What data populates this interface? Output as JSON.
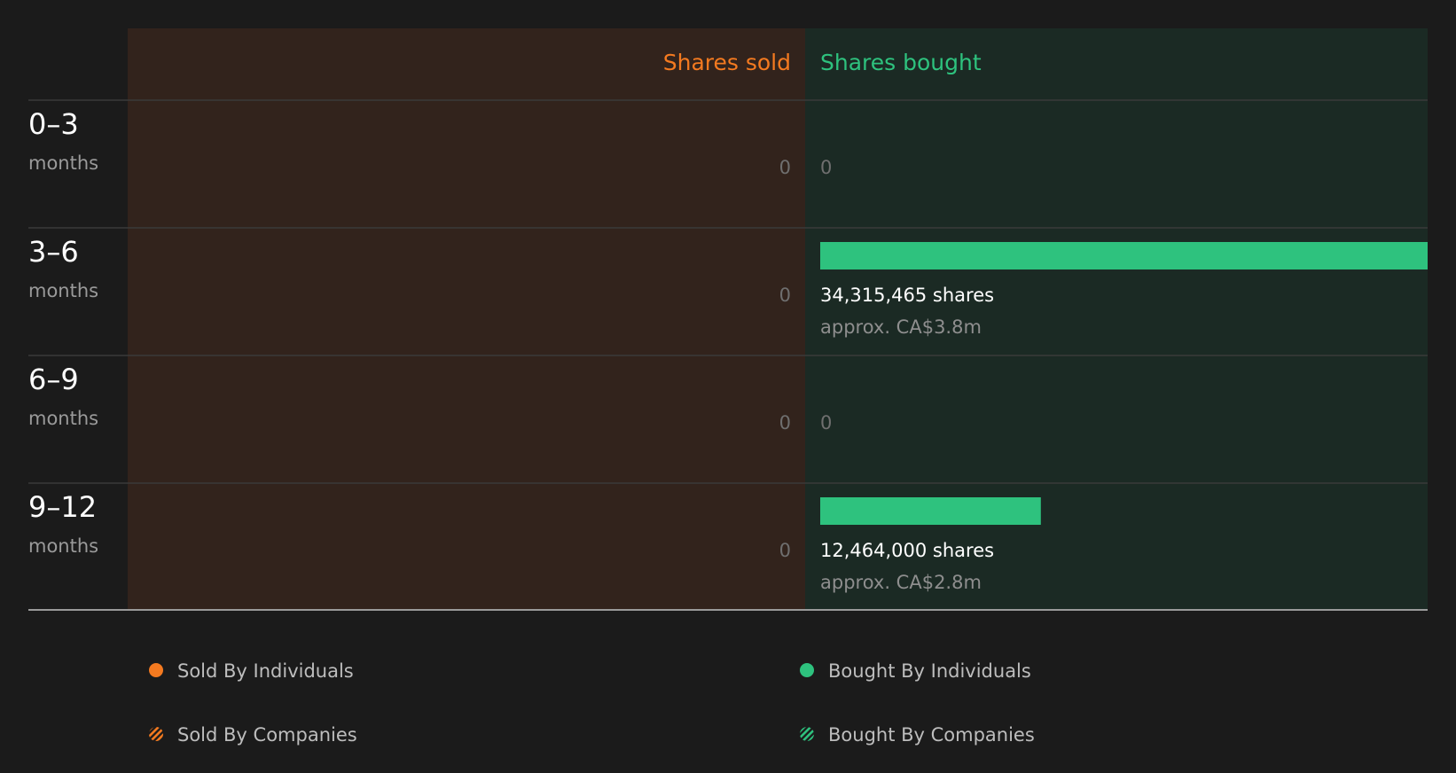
{
  "colors": {
    "background": "#1b1b1b",
    "sold_panel": "#32231c",
    "bought_panel": "#1b2a24",
    "sold_accent": "#f47a20",
    "bought_accent": "#2ec27e",
    "divider": "#3a3a3a",
    "baseline": "#9a9a9a"
  },
  "headers": {
    "sold": "Shares sold",
    "bought": "Shares bought"
  },
  "chart_data": {
    "type": "bar",
    "orientation": "horizontal-diverging",
    "categories": [
      {
        "range": "0–3",
        "unit": "months"
      },
      {
        "range": "3–6",
        "unit": "months"
      },
      {
        "range": "6–9",
        "unit": "months"
      },
      {
        "range": "9–12",
        "unit": "months"
      }
    ],
    "series": [
      {
        "name": "Shares sold",
        "values": [
          0,
          0,
          0,
          0
        ],
        "labels": [
          "0",
          "0",
          "0",
          "0"
        ]
      },
      {
        "name": "Shares bought",
        "values": [
          0,
          34315465,
          0,
          12464000
        ],
        "labels": [
          "0",
          "34,315,465 shares",
          "0",
          "12,464,000 shares"
        ],
        "approx": [
          "",
          "approx. CA$3.8m",
          "",
          "approx. CA$2.8m"
        ]
      }
    ],
    "xlim": [
      0,
      34315465
    ]
  },
  "legend": [
    {
      "label": "Sold By Individuals",
      "marker": "solid",
      "side": "sold"
    },
    {
      "label": "Bought By Individuals",
      "marker": "solid",
      "side": "bought"
    },
    {
      "label": "Sold By Companies",
      "marker": "hatched",
      "side": "sold"
    },
    {
      "label": "Bought By Companies",
      "marker": "hatched",
      "side": "bought"
    }
  ]
}
